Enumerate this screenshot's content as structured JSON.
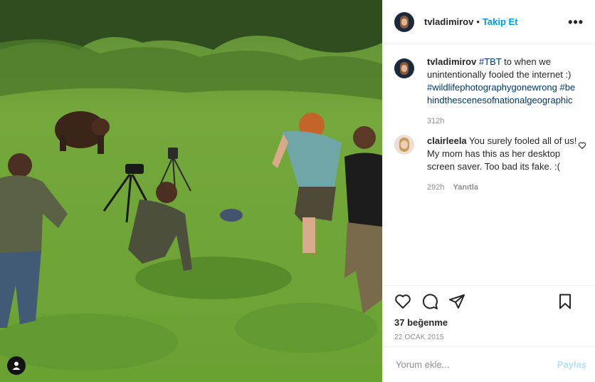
{
  "post": {
    "photo_desc": "photo",
    "author": "tvladimirov",
    "follow_label": "Takip Et",
    "separator": "•",
    "more_label": "•••"
  },
  "caption": {
    "username": "tvladimirov",
    "hashtag_tbt": "#TBT",
    "text": " to when we unintentionally fooled the internet :) ",
    "hashtag_1": "#wildlifephotographygonewrong",
    "hashtag_2": "#behindthescenesofnationalgeographic",
    "time": "312h"
  },
  "comment": {
    "username": "clairleela",
    "text": " You surely fooled all of us! My mom has this as her desktop screen saver. Too bad its fake. :(",
    "time": "292h",
    "reply_label": "Yanıtla"
  },
  "actions": {
    "likes": "37 beğenme",
    "date": "22 OCAK 2015",
    "icons": [
      "heart-icon",
      "comment-icon",
      "share-icon",
      "bookmark-icon"
    ]
  },
  "add_comment": {
    "placeholder": "Yorum ekle...",
    "post_label": "Paylaş"
  },
  "colors": {
    "link": "#0095f6",
    "hashtag": "#00376b",
    "muted": "#8e8e8e",
    "post_disabled": "#b2dffc"
  }
}
